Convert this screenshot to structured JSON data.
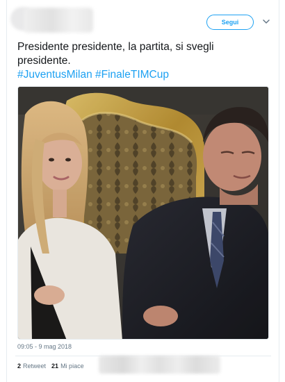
{
  "header": {
    "follow_label": "Segui",
    "caret_icon": "chevron-down-icon"
  },
  "tweet": {
    "line1": "Presidente presidente, la partita, si svegli",
    "line2": "presidente.",
    "hashtags": [
      "#JuventusMilan",
      "#FinaleTIMCup"
    ]
  },
  "meta": {
    "timestamp": "09:05 - 9 mag 2018"
  },
  "stats": {
    "retweet_count": "2",
    "retweet_label": "Retweet",
    "like_count": "21",
    "like_label": "Mi piace"
  },
  "colors": {
    "accent": "#1da1f2",
    "text": "#14171a",
    "muted": "#657786",
    "border": "#e6ecf0"
  }
}
